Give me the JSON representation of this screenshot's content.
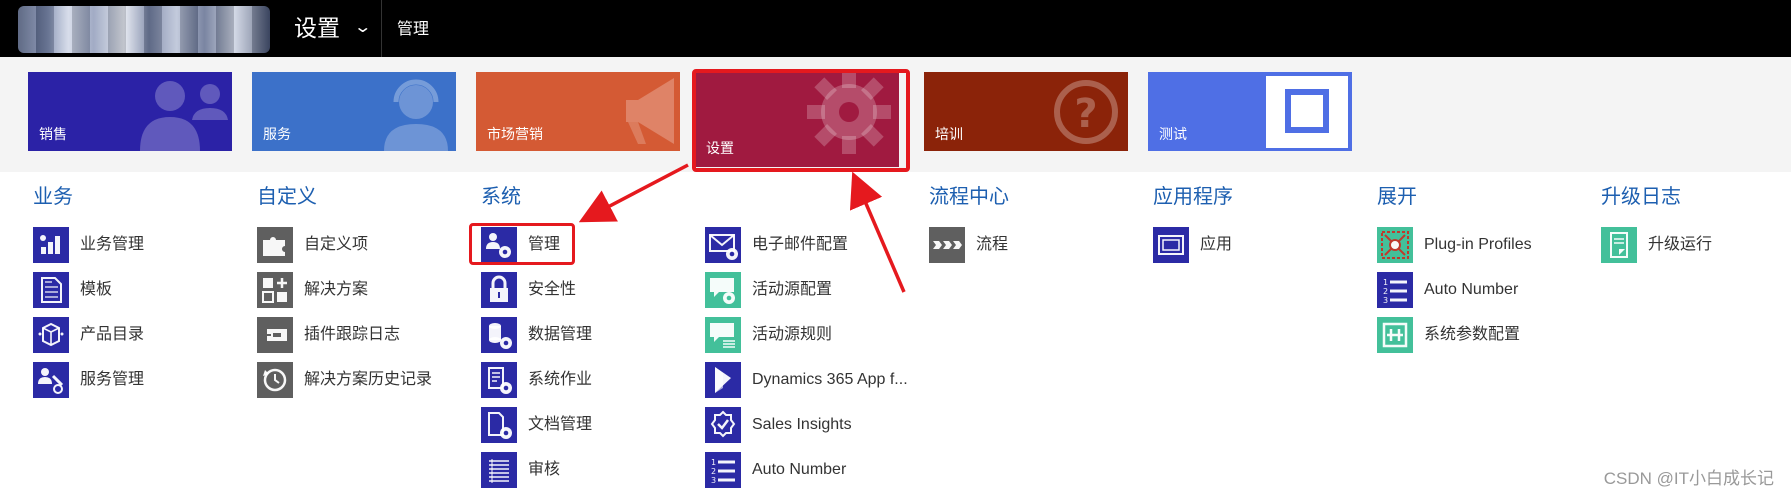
{
  "header": {
    "current_area": "设置",
    "breadcrumb": "管理"
  },
  "tiles": [
    {
      "label": "销售",
      "color": "#2b22a6",
      "icon": "people-icon"
    },
    {
      "label": "服务",
      "color": "#3c71c9",
      "icon": "headset-person-icon"
    },
    {
      "label": "市场营销",
      "color": "#d45a34",
      "icon": "megaphone-icon"
    },
    {
      "label": "设置",
      "color": "#a01a40",
      "icon": "gear-icon"
    },
    {
      "label": "培训",
      "color": "#8b2309",
      "icon": "question-icon"
    },
    {
      "label": "测试",
      "color": "#4f6fe5",
      "icon": "square-frame-icon"
    }
  ],
  "columns": [
    {
      "title": "业务",
      "items": [
        {
          "label": "业务管理",
          "icon": "business-chart-icon",
          "color": "#2b2aa5"
        },
        {
          "label": "模板",
          "icon": "document-icon",
          "color": "#2b2aa5"
        },
        {
          "label": "产品目录",
          "icon": "product-box-icon",
          "color": "#2b2aa5"
        },
        {
          "label": "服务管理",
          "icon": "service-tools-icon",
          "color": "#2b2aa5"
        }
      ]
    },
    {
      "title": "自定义",
      "items": [
        {
          "label": "自定义项",
          "icon": "puzzle-icon",
          "color": "#5f5f5f"
        },
        {
          "label": "解决方案",
          "icon": "solution-grid-icon",
          "color": "#5f5f5f"
        },
        {
          "label": "插件跟踪日志",
          "icon": "plugin-trace-icon",
          "color": "#5f5f5f"
        },
        {
          "label": "解决方案历史记录",
          "icon": "history-clock-icon",
          "color": "#5f5f5f"
        }
      ]
    },
    {
      "title": "系统",
      "items": [
        {
          "label": "管理",
          "icon": "admin-users-gear-icon",
          "color": "#2b2aa5"
        },
        {
          "label": "安全性",
          "icon": "lock-icon",
          "color": "#2b2aa5"
        },
        {
          "label": "数据管理",
          "icon": "database-gear-icon",
          "color": "#2b2aa5"
        },
        {
          "label": "系统作业",
          "icon": "system-jobs-icon",
          "color": "#2b2aa5"
        },
        {
          "label": "文档管理",
          "icon": "document-gear-icon",
          "color": "#2b2aa5"
        },
        {
          "label": "审核",
          "icon": "audit-list-icon",
          "color": "#2b2aa5"
        }
      ]
    },
    {
      "title": "",
      "items": [
        {
          "label": "电子邮件配置",
          "icon": "email-gear-icon",
          "color": "#2b2aa5"
        },
        {
          "label": "活动源配置",
          "icon": "activity-feed-gear-icon",
          "color": "#43c09a"
        },
        {
          "label": "活动源规则",
          "icon": "activity-feed-rules-icon",
          "color": "#43c09a"
        },
        {
          "label": "Dynamics 365 App f...",
          "icon": "dynamics-logo-icon",
          "color": "#2b2aa5"
        },
        {
          "label": "Sales Insights",
          "icon": "insights-badge-icon",
          "color": "#2b2aa5"
        },
        {
          "label": "Auto Number",
          "icon": "numbered-list-icon",
          "color": "#2b2aa5"
        }
      ]
    },
    {
      "title": "流程中心",
      "items": [
        {
          "label": "流程",
          "icon": "process-flow-icon",
          "color": "#5f5f5f"
        }
      ]
    },
    {
      "title": "应用程序",
      "items": [
        {
          "label": "应用",
          "icon": "app-window-icon",
          "color": "#2b2aa5"
        }
      ]
    },
    {
      "title": "展开",
      "items": [
        {
          "label": "Plug-in Profiles",
          "icon": "plugin-profile-icon",
          "color": "#43c09a"
        },
        {
          "label": "Auto Number",
          "icon": "numbered-list-icon",
          "color": "#2b2aa5"
        },
        {
          "label": "系统参数配置",
          "icon": "system-param-icon",
          "color": "#43c09a"
        }
      ]
    },
    {
      "title": "升级日志",
      "items": [
        {
          "label": "升级运行",
          "icon": "upgrade-scroll-icon",
          "color": "#43c09a"
        }
      ]
    }
  ],
  "watermark": "CSDN @IT小白成长记"
}
